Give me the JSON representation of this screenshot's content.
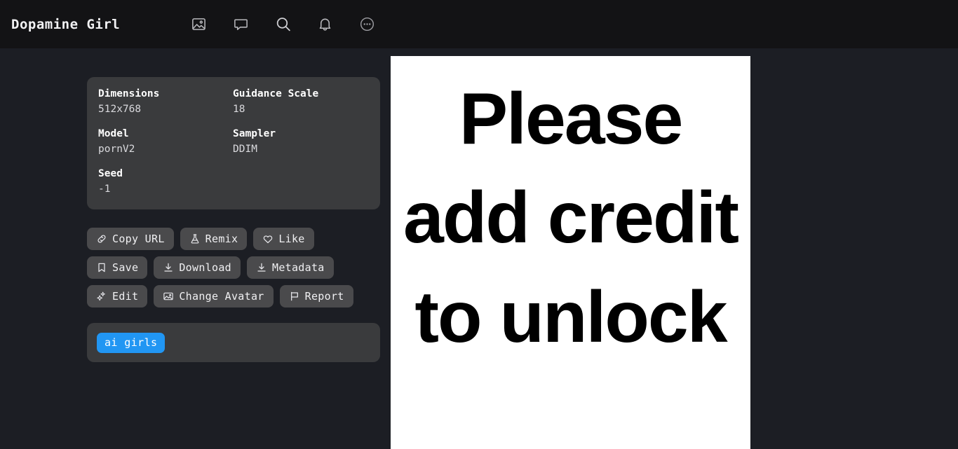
{
  "header": {
    "brand": "Dopamine Girl",
    "nav": [
      {
        "name": "gallery-icon",
        "icon": "image"
      },
      {
        "name": "messages-icon",
        "icon": "chat"
      },
      {
        "name": "search-icon",
        "icon": "search"
      },
      {
        "name": "notifications-icon",
        "icon": "bell"
      },
      {
        "name": "more-options-icon",
        "icon": "more-circle"
      }
    ]
  },
  "metadata": {
    "rows": [
      [
        {
          "label": "Dimensions",
          "value": "512x768"
        },
        {
          "label": "Guidance Scale",
          "value": "18"
        }
      ],
      [
        {
          "label": "Model",
          "value": "pornV2"
        },
        {
          "label": "Sampler",
          "value": "DDIM"
        }
      ],
      [
        {
          "label": "Seed",
          "value": "-1"
        },
        {
          "label": "",
          "value": ""
        }
      ]
    ]
  },
  "actions": {
    "rows": [
      [
        {
          "label": "Copy URL",
          "icon": "link",
          "name": "copy-url-button"
        },
        {
          "label": "Remix",
          "icon": "flask",
          "name": "remix-button"
        },
        {
          "label": "Like",
          "icon": "heart",
          "name": "like-button"
        }
      ],
      [
        {
          "label": "Save",
          "icon": "bookmark",
          "name": "save-button"
        },
        {
          "label": "Download",
          "icon": "download",
          "name": "download-button"
        },
        {
          "label": "Metadata",
          "icon": "download",
          "name": "metadata-button"
        }
      ],
      [
        {
          "label": "Edit",
          "icon": "sparkles",
          "name": "edit-button"
        },
        {
          "label": "Change Avatar",
          "icon": "image",
          "name": "change-avatar-button"
        },
        {
          "label": "Report",
          "icon": "flag",
          "name": "report-button"
        }
      ]
    ]
  },
  "tags": [
    {
      "label": "ai girls",
      "color": "#2196f3"
    }
  ],
  "image_panel": {
    "locked_message": "Please add credit to unlock"
  },
  "colors": {
    "page_background": "#1c1e24",
    "topbar_background": "#131315",
    "card_background": "#3a3b3d",
    "button_background": "#4a4a4c",
    "tag_accent": "#2196f3",
    "panel_background": "#ffffff",
    "text_primary": "#f2f2f4"
  }
}
